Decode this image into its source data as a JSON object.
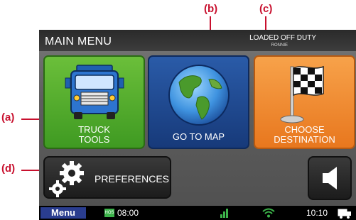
{
  "callouts": {
    "a": "(a)",
    "b": "(b)",
    "c": "(c)",
    "d": "(d)"
  },
  "header": {
    "title": "MAIN MENU",
    "status": "LOADED OFF DUTY",
    "driver": "RONNIE"
  },
  "tiles": [
    {
      "label_line1": "TRUCK",
      "label_line2": "TOOLS",
      "icon": "truck-icon"
    },
    {
      "label_line1": "GO TO MAP",
      "icon": "globe-icon"
    },
    {
      "label_line1": "CHOOSE",
      "label_line2": "DESTINATION",
      "icon": "checkered-flag-icon"
    }
  ],
  "preferences": {
    "label": "PREFERENCES",
    "icon": "gears-icon"
  },
  "speaker": {
    "icon": "speaker-icon"
  },
  "bottom": {
    "menu": "Menu",
    "hos": "HOS",
    "hos_time": "08:00",
    "clock": "10:10"
  },
  "colors": {
    "callout": "#c8102e",
    "green": "#4caf2a",
    "blue": "#1f4a94",
    "orange": "#f28c28"
  }
}
